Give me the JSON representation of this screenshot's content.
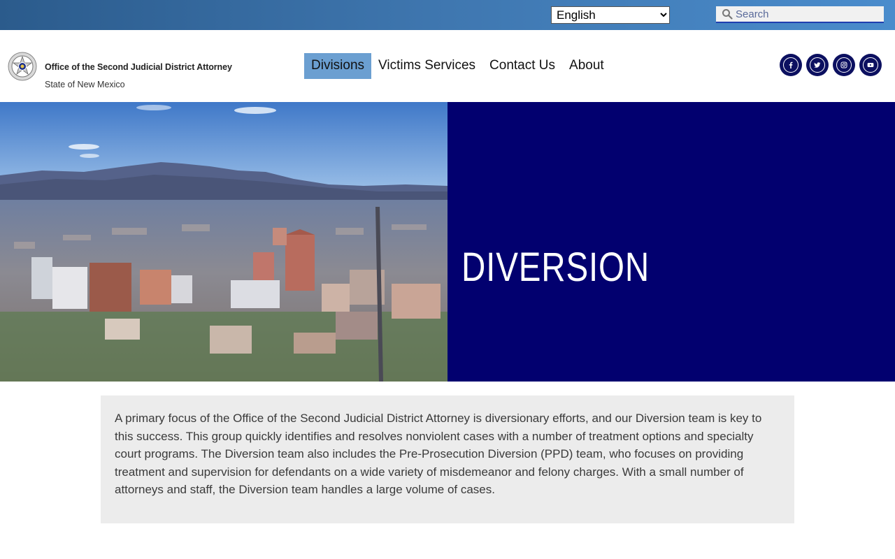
{
  "topbar": {
    "language": {
      "selected": "English",
      "options": [
        "English"
      ]
    },
    "search": {
      "placeholder": "Search",
      "value": ""
    }
  },
  "header": {
    "org_name": "Office of the Second Judicial District Attorney",
    "org_subtitle": "State of New Mexico",
    "nav": [
      {
        "label": "Divisions",
        "active": true
      },
      {
        "label": "Victims Services",
        "active": false
      },
      {
        "label": "Contact Us",
        "active": false
      },
      {
        "label": "About",
        "active": false
      }
    ],
    "social": [
      {
        "icon": "facebook-icon"
      },
      {
        "icon": "twitter-icon"
      },
      {
        "icon": "instagram-icon"
      },
      {
        "icon": "youtube-icon"
      }
    ]
  },
  "hero": {
    "title": "DIVERSION",
    "image": "city-skyline-mountains-photo"
  },
  "content": {
    "paragraph": "A primary focus of the Office of the Second Judicial District Attorney is diversionary efforts, and our Diversion team is key to this success. This group quickly identifies and resolves nonviolent cases with a number of treatment options and specialty court programs. The Diversion team also includes the Pre-Prosecution Diversion (PPD) team, who focuses on providing treatment and supervision for defendants on a wide variety of misdemeanor and felony charges. With a small number of attorneys and staff, the Diversion team handles a large volume of cases."
  },
  "colors": {
    "topbar": "#3f77b0",
    "nav_active": "#6b9fd1",
    "hero_panel": "#02006f",
    "social_bg": "#0c1060",
    "content_bg": "#ececec"
  }
}
